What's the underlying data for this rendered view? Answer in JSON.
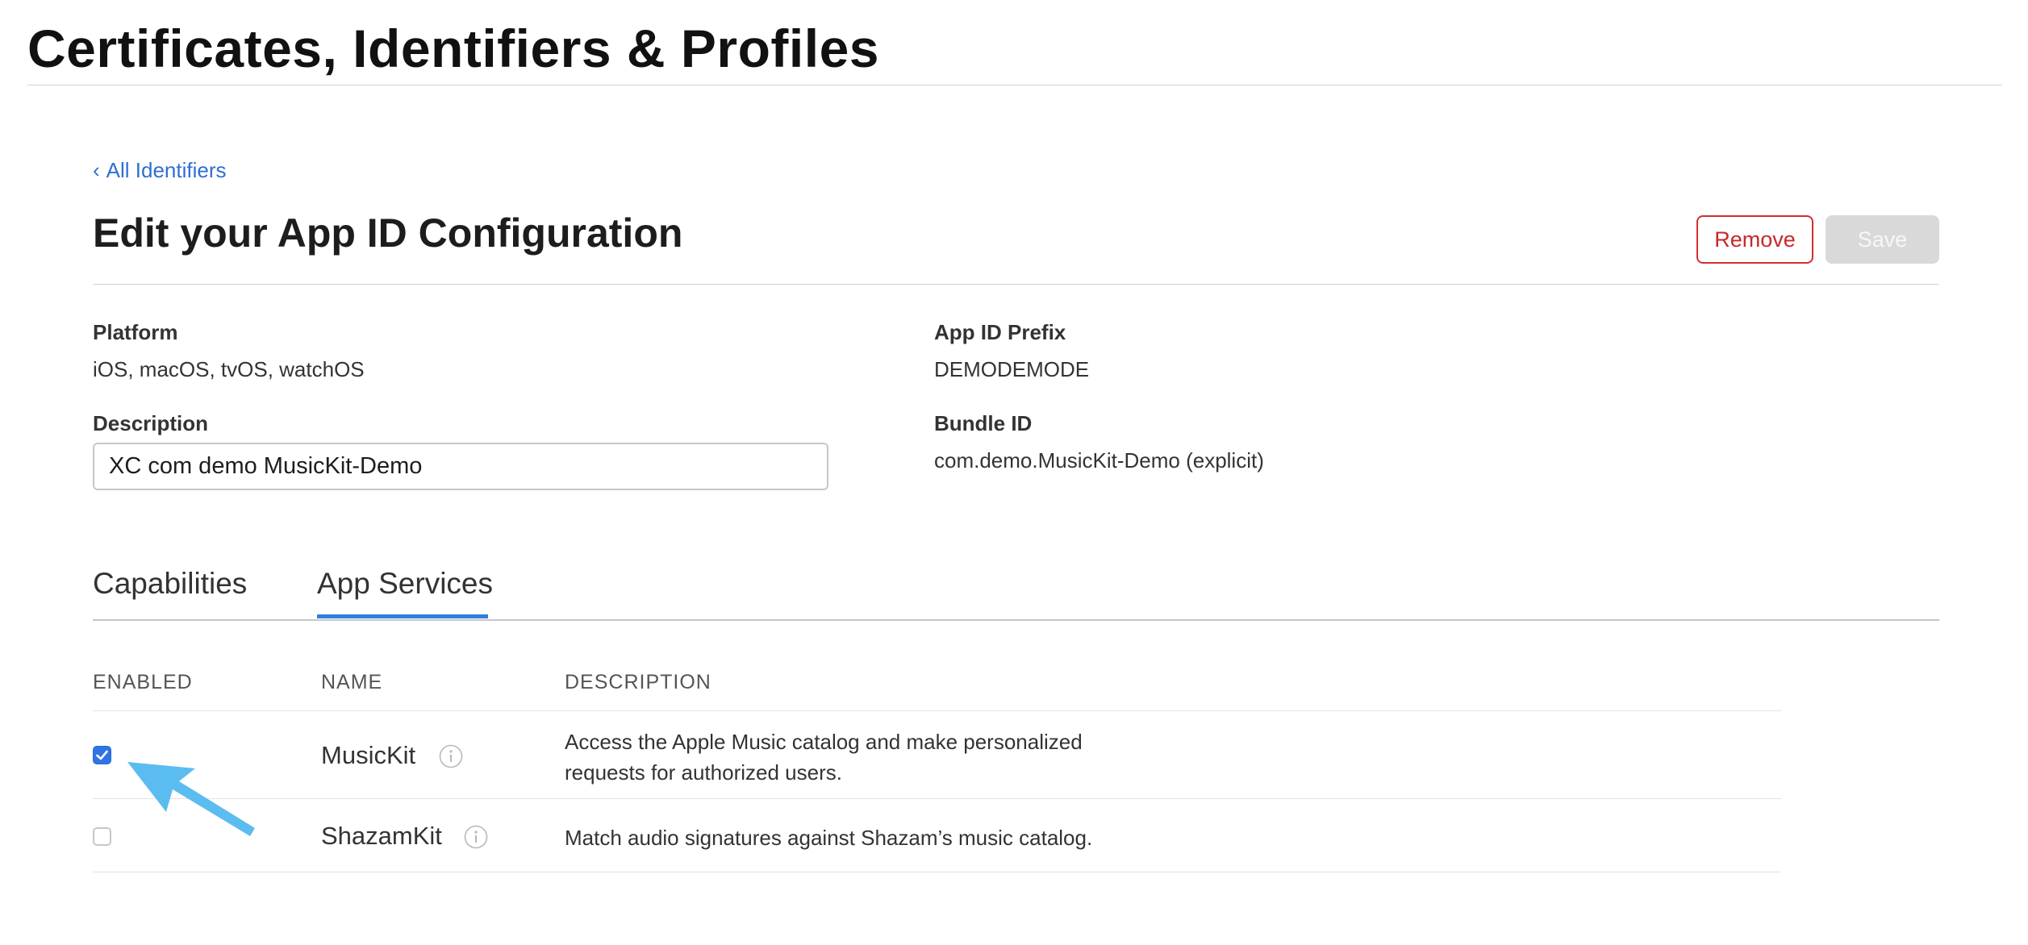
{
  "header": {
    "title": "Certificates, Identifiers & Profiles"
  },
  "nav": {
    "back_chevron": "‹",
    "back_label": "All Identifiers"
  },
  "page": {
    "heading": "Edit your App ID Configuration"
  },
  "actions": {
    "remove_label": "Remove",
    "save_label": "Save",
    "remove_color": "#c8282a",
    "save_disabled": true
  },
  "details": {
    "platform_label": "Platform",
    "platform_value": "iOS, macOS, tvOS, watchOS",
    "description_label": "Description",
    "description_value": "XC com demo MusicKit-Demo",
    "prefix_label": "App ID Prefix",
    "prefix_value": "DEMODEMODE",
    "bundle_label": "Bundle ID",
    "bundle_value": "com.demo.MusicKit-Demo (explicit)"
  },
  "tabs": [
    {
      "label": "Capabilities",
      "active": false
    },
    {
      "label": "App Services",
      "active": true
    }
  ],
  "table": {
    "columns": [
      "ENABLED",
      "NAME",
      "DESCRIPTION"
    ],
    "rows": [
      {
        "enabled": true,
        "name": "MusicKit",
        "info_icon": "info-icon",
        "description_lines": [
          "Access the Apple Music catalog and make personalized",
          "requests for authorized users."
        ]
      },
      {
        "enabled": false,
        "name": "ShazamKit",
        "info_icon": "info-icon",
        "description_lines": [
          "Match audio signatures against Shazam’s music catalog."
        ]
      }
    ]
  },
  "annotation": {
    "icon": "arrow-pointer-icon",
    "color": "#5bbcf0"
  },
  "colors": {
    "link": "#2f6fd1",
    "accent": "#2f7fe0",
    "checkbox_checked": "#2f74e6"
  }
}
